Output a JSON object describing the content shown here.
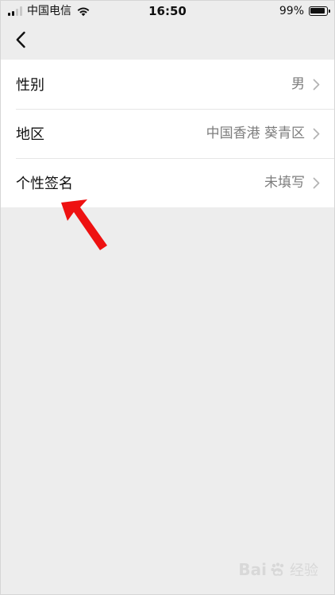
{
  "status_bar": {
    "carrier": "中国电信",
    "time": "16:50",
    "battery_percent_text": "99%",
    "battery_level": 0.99,
    "signal_level": 2,
    "signal_max": 4
  },
  "navigation": {
    "back_icon": "chevron-left-icon"
  },
  "settings": {
    "items": [
      {
        "label": "性别",
        "value": "男",
        "icon": "chevron-right-icon"
      },
      {
        "label": "地区",
        "value": "中国香港 葵青区",
        "icon": "chevron-right-icon"
      },
      {
        "label": "个性签名",
        "value": "未填写",
        "icon": "chevron-right-icon"
      }
    ]
  },
  "annotation": {
    "arrow_color": "#ee1111"
  },
  "watermark": {
    "brand_left": "Bai",
    "brand_right": "经验",
    "icon": "baidu-paw-icon"
  },
  "colors": {
    "page_background": "#ededed",
    "card_background": "#ffffff",
    "primary_text": "#111111",
    "secondary_text": "#7d7d7d",
    "divider": "#e6e6e6"
  }
}
